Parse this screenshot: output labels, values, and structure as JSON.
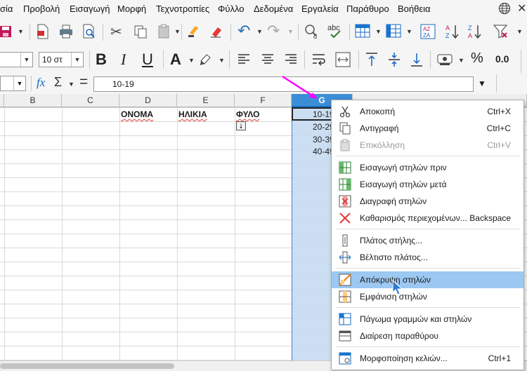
{
  "menubar": {
    "items": [
      "σία",
      "Προβολή",
      "Εισαγωγή",
      "Μορφή",
      "Τεχνοτροπίες",
      "Φύλλο",
      "Δεδομένα",
      "Εργαλεία",
      "Παράθυρο",
      "Βοήθεια"
    ]
  },
  "toolbar": {
    "font_size": "10 στ",
    "bold": "B",
    "italic": "I",
    "underline": "U",
    "font_color": "A",
    "percent": "%",
    "decimal": "0.0"
  },
  "formula_bar": {
    "fx": "fx",
    "sigma": "Σ",
    "equals": "=",
    "content": "10-19"
  },
  "columns": [
    "B",
    "C",
    "D",
    "E",
    "F",
    "G"
  ],
  "selected_column": "G",
  "cells": {
    "d1": "ΟΝΟΜΑ",
    "e1": "ΗΛΙΚΙΑ",
    "f1": "ΦΥΛΟ",
    "g_values": [
      "10-19",
      "20-29",
      "30-39",
      "40-49"
    ]
  },
  "context_menu": {
    "items": [
      {
        "label": "Αποκοπή",
        "shortcut": "Ctrl+X",
        "icon": "scissors-icon",
        "enabled": true
      },
      {
        "label": "Αντιγραφή",
        "shortcut": "Ctrl+C",
        "icon": "copy-icon",
        "enabled": true
      },
      {
        "label": "Επικόλληση",
        "shortcut": "Ctrl+V",
        "icon": "paste-icon",
        "enabled": false
      },
      {
        "label": "Εισαγωγή στηλών πριν",
        "shortcut": "",
        "icon": "insert-columns-before-icon",
        "enabled": true
      },
      {
        "label": "Εισαγωγή στηλών μετά",
        "shortcut": "",
        "icon": "insert-columns-after-icon",
        "enabled": true
      },
      {
        "label": "Διαγραφή στηλών",
        "shortcut": "",
        "icon": "delete-columns-icon",
        "enabled": true
      },
      {
        "label": "Καθαρισμός περιεχομένων...",
        "shortcut": "Backspace",
        "icon": "clear-contents-icon",
        "enabled": true
      },
      {
        "label": "Πλάτος στήλης...",
        "shortcut": "",
        "icon": "column-width-icon",
        "enabled": true
      },
      {
        "label": "Βέλτιστο πλάτος...",
        "shortcut": "",
        "icon": "optimal-width-icon",
        "enabled": true
      },
      {
        "label": "Απόκρυψη στηλών",
        "shortcut": "",
        "icon": "hide-columns-icon",
        "enabled": true,
        "highlighted": true
      },
      {
        "label": "Εμφάνιση στηλών",
        "shortcut": "",
        "icon": "show-columns-icon",
        "enabled": true
      },
      {
        "label": "Πάγωμα γραμμών και στηλών",
        "shortcut": "",
        "icon": "freeze-icon",
        "enabled": true
      },
      {
        "label": "Διαίρεση παραθύρου",
        "shortcut": "",
        "icon": "split-window-icon",
        "enabled": true
      },
      {
        "label": "Μορφοποίηση κελιών...",
        "shortcut": "Ctrl+1",
        "icon": "format-cells-icon",
        "enabled": true
      }
    ]
  },
  "colors": {
    "selection": "#c6dbf1",
    "header_selected": "#3b8ed6",
    "menu_highlight": "#9cc8f2",
    "annotation_arrow": "#ff00ff"
  }
}
